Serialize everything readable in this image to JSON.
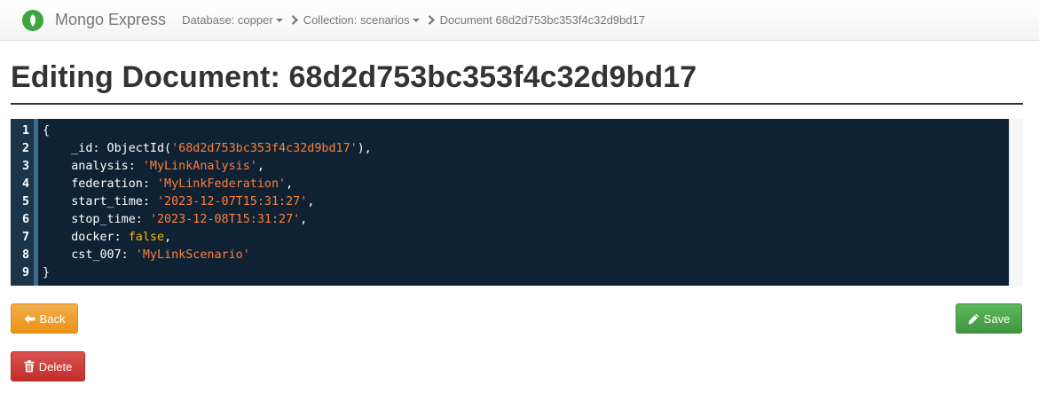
{
  "navbar": {
    "brand": "Mongo Express",
    "breadcrumbs": [
      {
        "label": "Database: copper",
        "dropdown": true
      },
      {
        "label": "Collection: scenarios",
        "dropdown": true
      },
      {
        "label": "Document 68d2d753bc353f4c32d9bd17",
        "dropdown": false
      }
    ]
  },
  "page": {
    "title": "Editing Document: 68d2d753bc353f4c32d9bd17"
  },
  "editor": {
    "line_numbers": [
      "1",
      "2",
      "3",
      "4",
      "5",
      "6",
      "7",
      "8",
      "9"
    ],
    "lines": [
      "{",
      "    _id: ObjectId('68d2d753bc353f4c32d9bd17'),",
      "    analysis: 'MyLinkAnalysis',",
      "    federation: 'MyLinkFederation',",
      "    start_time: '2023-12-07T15:31:27',",
      "    stop_time: '2023-12-08T15:31:27',",
      "    docker: false,",
      "    cst_007: 'MyLinkScenario'",
      "}"
    ],
    "colors": {
      "background": "#0f2233",
      "gutter": "#1b3447",
      "string": "#ff7e3d",
      "boolean": "#ffbb00"
    }
  },
  "buttons": {
    "back": {
      "label": "Back",
      "icon": "arrow-left-icon",
      "color": "#f0ad4e"
    },
    "save": {
      "label": "Save",
      "icon": "pencil-icon",
      "color": "#5cb85c"
    },
    "delete": {
      "label": "Delete",
      "icon": "trash-icon",
      "color": "#d9534f"
    }
  }
}
